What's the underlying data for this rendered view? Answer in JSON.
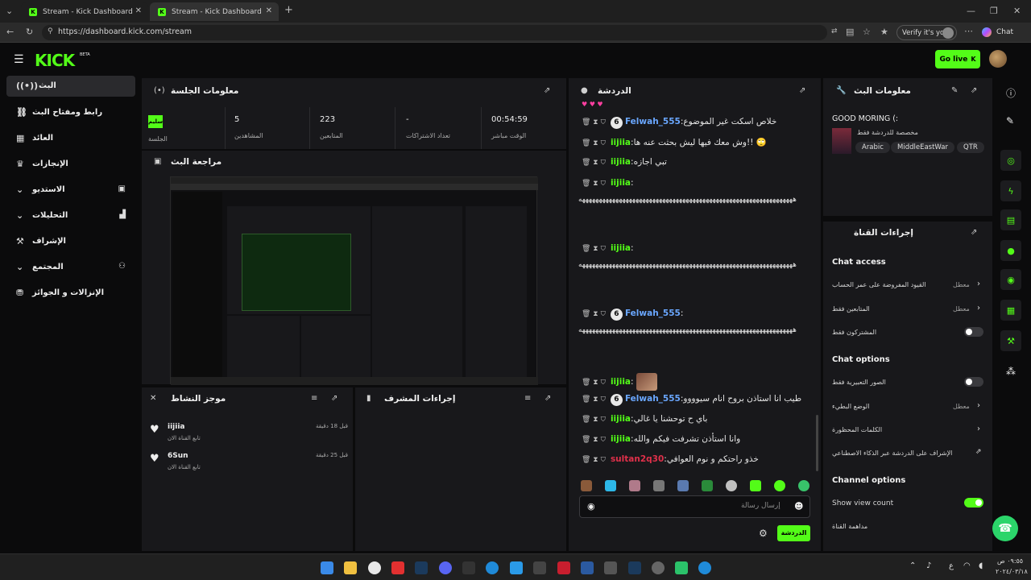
{
  "browser": {
    "tabs": [
      {
        "title": "Stream - Kick Dashboard"
      },
      {
        "title": "Stream - Kick Dashboard"
      }
    ],
    "new_tab": "+",
    "url": "https://dashboard.kick.com/stream",
    "verify_label": "Verify it's you",
    "chat_label": "Chat"
  },
  "app": {
    "logo": "KICK",
    "logo_badge": "BETA",
    "go_live": "Go live"
  },
  "sidebar": {
    "items": [
      {
        "label": "البث"
      },
      {
        "label": "رابط ومفتاح البث"
      },
      {
        "label": "العائد"
      },
      {
        "label": "الإنجازات"
      },
      {
        "label": "الاستديو"
      },
      {
        "label": "التحليلات"
      },
      {
        "label": "الإشراف"
      },
      {
        "label": "المجتمع"
      },
      {
        "label": "الإنزالات و الجوائز"
      }
    ]
  },
  "session": {
    "title": "معلومات الجلسة",
    "status_badge": "سليم",
    "stats": [
      {
        "label": "الجلسة",
        "value": ""
      },
      {
        "label": "المشاهدين",
        "value": "5"
      },
      {
        "label": "المتابعين",
        "value": "223"
      },
      {
        "label": "تعداد الاشتراكات",
        "value": "-"
      },
      {
        "label": "الوقت مباشر",
        "value": "00:54:59"
      }
    ]
  },
  "preview": {
    "title": "مراجعة البث"
  },
  "activity": {
    "title": "موجز النشاط",
    "items": [
      {
        "name": "iijiia",
        "desc": "تابع القناة الان",
        "time": "قبل 18 دقيقة"
      },
      {
        "name": "6Sun",
        "desc": "تابع القناة الان",
        "time": "قبل 25 دقيقة"
      }
    ]
  },
  "mod_actions": {
    "title": "إجراءات المشرف"
  },
  "chat": {
    "title": "الدردشة",
    "messages": [
      {
        "user": "Felwah_555",
        "text": ":خلاص اسكت غير الموضوع",
        "color": "#6aa7ff",
        "badge": "6"
      },
      {
        "user": "iijiia",
        "text": ":وش معك فيها ليش بحثت عنه ها!! 🙄",
        "color": "#53fc18",
        "badge": ""
      },
      {
        "user": "iijiia",
        "text": ":تبي اجازه",
        "color": "#53fc18",
        "badge": ""
      },
      {
        "user": "iijiia",
        "text": ":",
        "color": "#53fc18",
        "badge": ""
      },
      {
        "user": "iijiia",
        "text": ":",
        "color": "#53fc18",
        "badge": ""
      },
      {
        "user": "Felwah_555",
        "text": ":",
        "color": "#6aa7ff",
        "badge": "6"
      },
      {
        "user": "iijiia",
        "text": ":",
        "color": "#53fc18",
        "badge": ""
      },
      {
        "user": "Felwah_555",
        "text": ":طيب انا استاذن بروح انام سيوووو",
        "color": "#6aa7ff",
        "badge": "6"
      },
      {
        "user": "iijiia",
        "text": ":باي ح توحشنا يا غالي",
        "color": "#53fc18",
        "badge": ""
      },
      {
        "user": "iijiia",
        "text": ":وانا استأذن تشرفت فيكم والله",
        "color": "#53fc18",
        "badge": ""
      },
      {
        "user": "sultan2q30",
        "text": ":خذو راحتكم و نوم العوافي",
        "color": "#e0304a",
        "badge": ""
      }
    ],
    "spam_text": "ههههههههههههههههههههههههههههههههههههههههههههههههههههههههههههههههه",
    "input_placeholder": "إرسال رسالة",
    "send_button": "الدردشة"
  },
  "stream_info": {
    "title": "معلومات البث",
    "stream_title": "GOOD MORING (:",
    "category": "مخصصة للدردشة فقط",
    "tags": [
      "Arabic",
      "MiddleEastWar",
      "QTR"
    ]
  },
  "channel_actions": {
    "title": "إجراءات القناة",
    "chat_access_heading": "Chat access",
    "chat_access": [
      {
        "label": "القيود المفروضة على عمر الحساب",
        "value": "معطل"
      },
      {
        "label": "المتابعين فقط",
        "value": "معطل"
      },
      {
        "label": "المشتركون فقط",
        "value": ""
      }
    ],
    "chat_options_heading": "Chat options",
    "chat_options": [
      {
        "label": "الصور التعبيرية فقط",
        "value": ""
      },
      {
        "label": "الوضع البطيء",
        "value": "معطل"
      },
      {
        "label": "الكلمات المحظورة",
        "value": ""
      },
      {
        "label": "الإشراف على الدردشة عبر الذكاء الاصطناعي",
        "value": ""
      }
    ],
    "channel_options_heading": "Channel options",
    "channel_options": [
      {
        "label": "Show view count",
        "value": ""
      },
      {
        "label": "مداهمة القناة",
        "value": ""
      }
    ]
  },
  "taskbar": {
    "time": "٠٩:٥٥ ص",
    "date": "٢٠٢٤/٠٣/١٨",
    "lang": "ع"
  },
  "colors": {
    "accent": "#53fc18",
    "panel": "#18181b",
    "bg": "#0b0b0c"
  }
}
